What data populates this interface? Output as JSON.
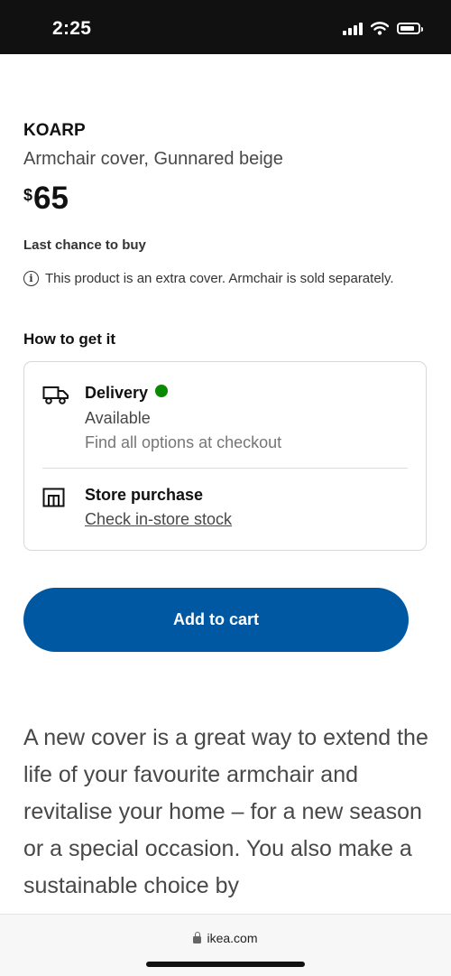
{
  "status_bar": {
    "time": "2:25",
    "icons": [
      "signal-icon",
      "wifi-icon",
      "battery-icon"
    ]
  },
  "product": {
    "name": "KOARP",
    "description": "Armchair cover, Gunnared beige",
    "currency": "$",
    "price": "65",
    "availability_note": "Last chance to buy",
    "notice": "This product is an extra cover. Armchair is sold separately."
  },
  "fulfilment": {
    "title": "How to get it",
    "delivery": {
      "title": "Delivery",
      "status": "Available",
      "detail": "Find all options at checkout",
      "status_color": "#0a8a00"
    },
    "store": {
      "title": "Store purchase",
      "link": "Check in-store stock"
    }
  },
  "cart": {
    "label": "Add to cart",
    "color": "#0058a3"
  },
  "marketing_text": "A new cover is a great way to extend the life of your favourite armchair and revitalise your home – for a new season or a special occasion. You also make a sustainable choice by",
  "browser": {
    "url": "ikea.com"
  }
}
